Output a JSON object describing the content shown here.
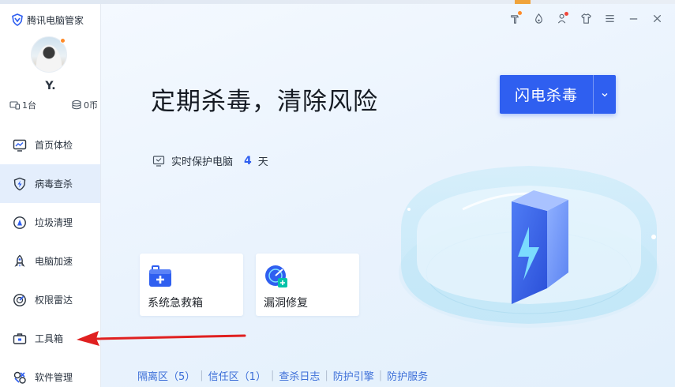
{
  "app": {
    "brand": "腾讯电脑管家"
  },
  "user": {
    "name": "Y.",
    "devices": "1台",
    "coins": "0币"
  },
  "nav": [
    {
      "label": "首页体检",
      "icon": "monitor-chart-icon",
      "active": false
    },
    {
      "label": "病毒查杀",
      "icon": "lightning-shield-icon",
      "active": true
    },
    {
      "label": "垃圾清理",
      "icon": "broom-icon",
      "active": false
    },
    {
      "label": "电脑加速",
      "icon": "rocket-icon",
      "active": false
    },
    {
      "label": "权限雷达",
      "icon": "radar-icon",
      "active": false
    },
    {
      "label": "工具箱",
      "icon": "toolbox-icon",
      "active": false
    },
    {
      "label": "软件管理",
      "icon": "apps-icon",
      "active": false
    }
  ],
  "main": {
    "headline": "定期杀毒，清除风险",
    "scan_button": "闪电杀毒",
    "protect_text": "实时保护电脑",
    "protect_days": "4",
    "protect_unit": "天",
    "tools": [
      {
        "label": "系统急救箱",
        "icon": "first-aid-kit-icon"
      },
      {
        "label": "漏洞修复",
        "icon": "patch-radar-icon"
      }
    ],
    "links": [
      "隔离区（5）",
      "信任区（1）",
      "查杀日志",
      "防护引擎",
      "防护服务"
    ]
  },
  "colors": {
    "accent": "#2f5ff0",
    "link": "#3d6fd8",
    "arrow": "#e02020"
  }
}
